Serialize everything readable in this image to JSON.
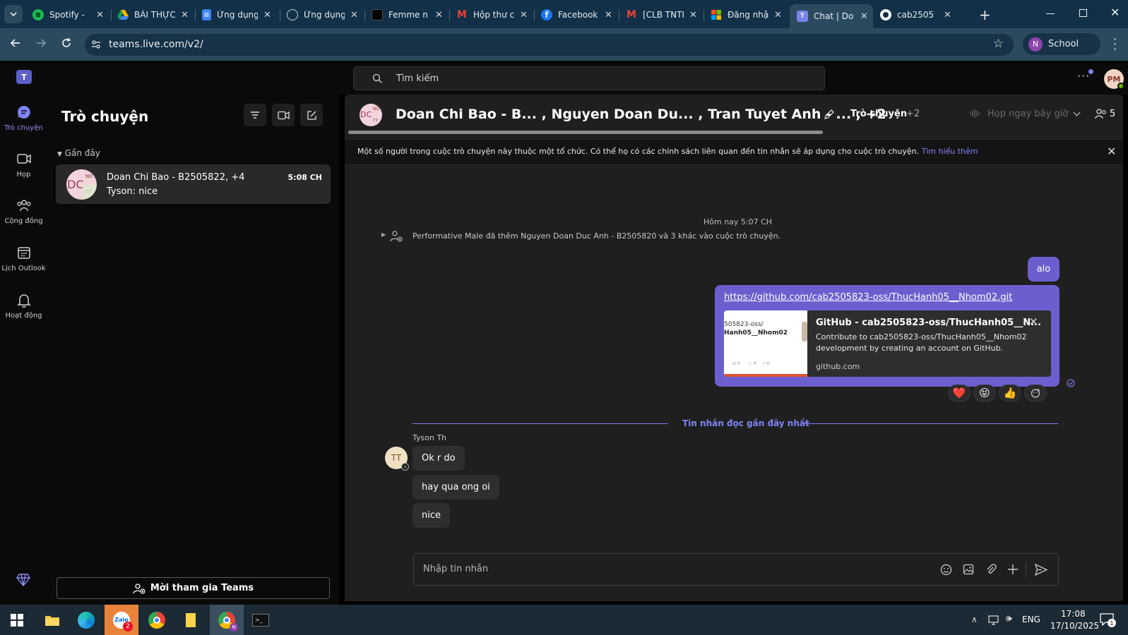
{
  "browser": {
    "tabs": [
      {
        "label": "Spotify - ",
        "icon": "spotify-icon",
        "color": "#1db954"
      },
      {
        "label": "BÀI THỰC",
        "icon": "google-drive-icon",
        "color": "#f4b400"
      },
      {
        "label": "Ứng dụng",
        "icon": "google-docs-icon",
        "color": "#4285f4"
      },
      {
        "label": "Ứng dụng",
        "icon": "globe-icon",
        "color": "#9aa0a6"
      },
      {
        "label": "Femme n",
        "icon": "black-square-icon",
        "color": "#111111"
      },
      {
        "label": "Hộp thư c",
        "icon": "gmail-icon",
        "color": "#ea4335"
      },
      {
        "label": "Facebook",
        "icon": "facebook-icon",
        "color": "#1877f2"
      },
      {
        "label": "[CLB TNTI",
        "icon": "gmail-icon",
        "color": "#ea4335"
      },
      {
        "label": "Đăng nhậ",
        "icon": "microsoft-icon",
        "color": "#f25022"
      },
      {
        "label": "Chat | Do",
        "icon": "teams-icon",
        "color": "#7b83eb"
      },
      {
        "label": "cab2505",
        "icon": "github-icon",
        "color": "#ffffff"
      }
    ],
    "url": "teams.live.com/v2/",
    "profile_initial": "N",
    "profile_label": "School"
  },
  "teams": {
    "search_placeholder": "Tìm kiếm",
    "user_avatar": "PM",
    "rail": [
      {
        "label": "Trò chuyện",
        "icon": "chat-icon"
      },
      {
        "label": "Họp",
        "icon": "video-icon"
      },
      {
        "label": "Cộng đồng",
        "icon": "community-icon"
      },
      {
        "label": "Lịch Outlook",
        "icon": "calendar-icon"
      },
      {
        "label": "Hoạt động",
        "icon": "bell-icon"
      }
    ],
    "list": {
      "title": "Trò chuyện",
      "section": "Gần đây",
      "chats": [
        {
          "name": "Doan Chi Bao - B2505822, +4",
          "time": "5:08 CH",
          "preview": "Tyson: nice",
          "avatar_main": "DC",
          "avatar_a": "ND",
          "avatar_b": "TT"
        }
      ],
      "invite_button": "Mời tham gia Teams"
    },
    "chat": {
      "header_title": "Doan Chi Bao - B... , Nguyen Doan Du... , Tran Tuyet Anh - ... , +2",
      "tab_chat": "Trò chuyện",
      "tab_more": "+2",
      "meet_now": "Họp ngay bây giờ",
      "participants": "5",
      "banner_text": "Một số người trong cuộc trò chuyện này thuộc một tổ chức. Có thể họ có các chính sách liên quan đến tin nhắn sẽ áp dụng cho cuộc trò chuyện.",
      "banner_link": "Tìm hiểu thêm",
      "timestamp": "Hôm nay 5:07 CH",
      "system_message": "Performative Male đã thêm Nguyen Doan Duc Anh - B2505820 và 3 khác vào cuộc trò chuyện.",
      "my_messages": [
        "alo"
      ],
      "link": "https://github.com/cab2505823-oss/ThucHanh05__Nhom02.git",
      "preview": {
        "title": "GitHub - cab2505823-oss/ThucHanh05__N...",
        "description": "Contribute to cab2505823-oss/ThucHanh05__Nhom02 development by creating an account on GitHub.",
        "domain": "github.com",
        "thumb_line1": "505823-oss/",
        "thumb_line2": "Hanh05__Nhom02"
      },
      "reactions": [
        "❤️",
        "😝",
        "👍"
      ],
      "last_read": "Tin nhắn đọc gần đây nhất",
      "sender": "Tyson Th",
      "sender_avatar": "TT",
      "their_messages": [
        "Ok r do",
        "hay qua ong oi",
        "nice"
      ],
      "compose_placeholder": "Nhập tin nhắn"
    }
  },
  "taskbar": {
    "lang": "ENG",
    "time": "17:08",
    "date": "17/10/2025",
    "zalo_badge": "2",
    "notif_badge": "1"
  },
  "colors": {
    "accent": "#6b5fd0",
    "link": "#7f85f5"
  }
}
